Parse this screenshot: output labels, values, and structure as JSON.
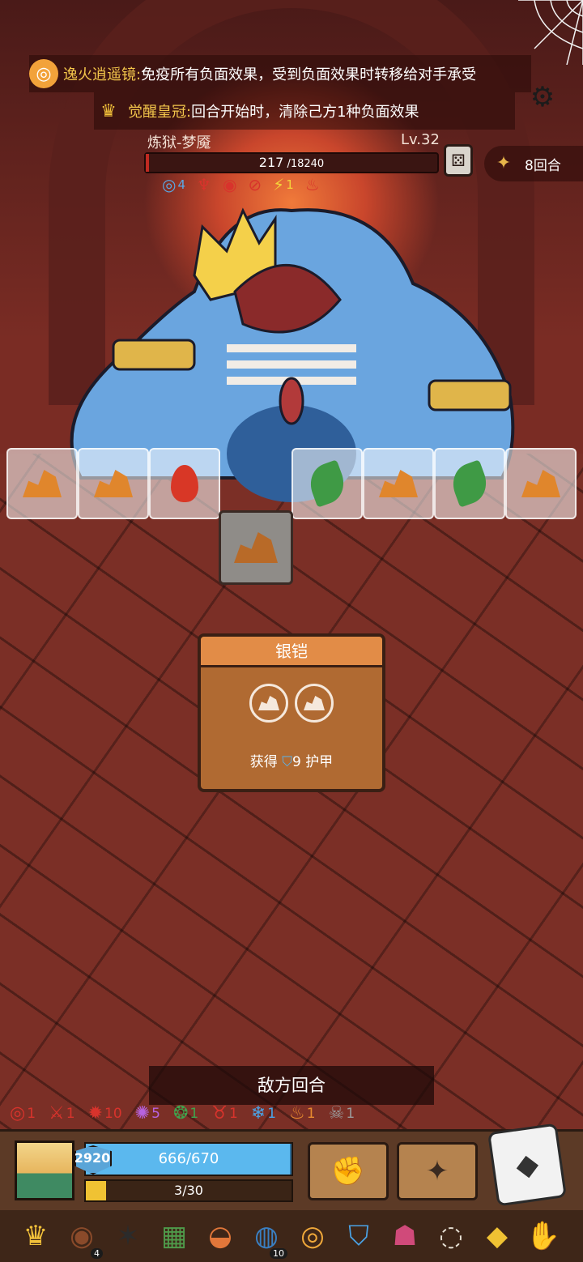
{
  "buffs": [
    {
      "icon": "mirror-icon",
      "name": "逸火逍遥镜:",
      "desc": "免疫所有负面效果，受到负面效果时转移给对手承受"
    },
    {
      "icon": "crown-icon",
      "name": "觉醒皇冠:",
      "desc": "回合开始时，清除己方1种负面效果"
    }
  ],
  "enemy": {
    "name": "炼狱-梦魇",
    "level": "Lv.32",
    "hp_current": "217",
    "hp_max": " /18240",
    "hp_fraction": 0.012,
    "status": [
      {
        "icon": "spiral-icon",
        "value": "4",
        "color": "#5aa9e6"
      },
      {
        "icon": "claw-icon",
        "value": "",
        "color": "#d8332c"
      },
      {
        "icon": "target-icon",
        "value": "",
        "color": "#d8332c"
      },
      {
        "icon": "slash-icon",
        "value": "",
        "color": "#d8332c"
      },
      {
        "icon": "bolt-icon",
        "value": "1",
        "color": "#f5d43a"
      },
      {
        "icon": "flame-icon",
        "value": "",
        "color": "#d8332c"
      }
    ]
  },
  "round": {
    "label": "8回合"
  },
  "dice_row": [
    {
      "face": "rock"
    },
    {
      "face": "rock"
    },
    {
      "face": "fire"
    },
    {
      "face": "leaf"
    },
    {
      "face": "rock"
    },
    {
      "face": "leaf"
    },
    {
      "face": "rock"
    }
  ],
  "card": {
    "title": "银铠",
    "effect_prefix": "获得",
    "effect_value": "9",
    "effect_suffix": "护甲"
  },
  "turn_banner": "敌方回合",
  "player_status": [
    {
      "icon": "spiral-icon",
      "value": "1",
      "color": "#d8332c"
    },
    {
      "icon": "sword-icon",
      "value": "1",
      "color": "#d8332c"
    },
    {
      "icon": "burst-icon",
      "value": "10",
      "color": "#d8332c"
    },
    {
      "icon": "virus-icon",
      "value": "5",
      "color": "#b663e0"
    },
    {
      "icon": "poison-icon",
      "value": "1",
      "color": "#3fa34d"
    },
    {
      "icon": "devil-icon",
      "value": "1",
      "color": "#d8332c"
    },
    {
      "icon": "snowflake-icon",
      "value": "1",
      "color": "#4aa3e6"
    },
    {
      "icon": "fire-icon",
      "value": "1",
      "color": "#e88a2f"
    },
    {
      "icon": "skull-icon",
      "value": "1",
      "color": "#9a9a9a"
    }
  ],
  "player": {
    "armor": "2920",
    "hp_text": "666/670",
    "hp_fraction": 0.994,
    "energy_text": "3/30",
    "energy_fraction": 0.1
  },
  "relics": [
    {
      "icon": "crown-icon",
      "count": ""
    },
    {
      "icon": "button-icon",
      "count": "4"
    },
    {
      "icon": "ninja-icon",
      "count": ""
    },
    {
      "icon": "green-book-icon",
      "count": ""
    },
    {
      "icon": "meat-icon",
      "count": ""
    },
    {
      "icon": "plate-icon",
      "count": "10"
    },
    {
      "icon": "donut-icon",
      "count": ""
    },
    {
      "icon": "blue-crest-icon",
      "count": ""
    },
    {
      "icon": "mask-icon",
      "count": ""
    },
    {
      "icon": "mirror-icon",
      "count": ""
    },
    {
      "icon": "gem-icon",
      "count": ""
    },
    {
      "icon": "glove-icon",
      "count": ""
    }
  ]
}
